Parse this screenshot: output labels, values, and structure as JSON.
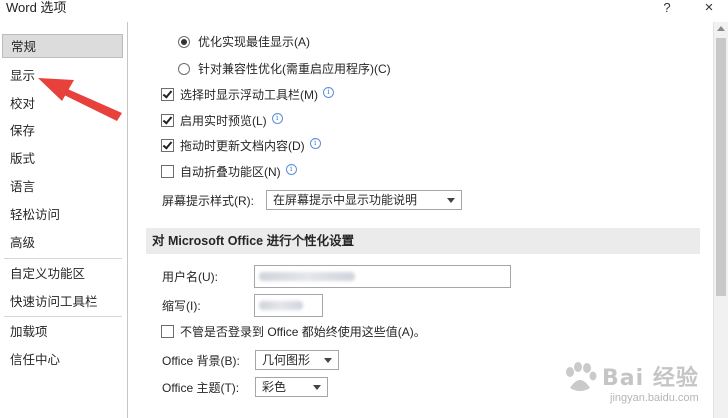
{
  "window": {
    "title": "Word 选项",
    "help_label": "?",
    "close_label": "×"
  },
  "sidebar": {
    "items": [
      {
        "label": "常规"
      },
      {
        "label": "显示"
      },
      {
        "label": "校对"
      },
      {
        "label": "保存"
      },
      {
        "label": "版式"
      },
      {
        "label": "语言"
      },
      {
        "label": "轻松访问"
      },
      {
        "label": "高级"
      },
      {
        "label": "自定义功能区"
      },
      {
        "label": "快速访问工具栏"
      },
      {
        "label": "加载项"
      },
      {
        "label": "信任中心"
      }
    ],
    "selected": "常规"
  },
  "ui_options": {
    "radio_best_display": "优化实现最佳显示(A)",
    "radio_compat": "针对兼容性优化(需重启应用程序)(C)",
    "show_mini_toolbar": "选择时显示浮动工具栏(M)",
    "live_preview": "启用实时预览(L)",
    "update_while_drag": "拖动时更新文档内容(D)",
    "collapse_ribbon": "自动折叠功能区(N)",
    "screentip_label": "屏幕提示样式(R):",
    "screentip_value": "在屏幕提示中显示功能说明",
    "info_glyph": "i"
  },
  "personalize": {
    "section_title": "对 Microsoft Office 进行个性化设置",
    "username_label": "用户名(U):",
    "initials_label": "缩写(I):",
    "always_use": "不管是否登录到 Office 都始终使用这些值(A)。",
    "background_label": "Office 背景(B):",
    "background_value": "几何图形",
    "theme_label": "Office 主题(T):",
    "theme_value": "彩色"
  },
  "watermark": {
    "brand": "Bai 经验",
    "url": "jingyan.baidu.com"
  },
  "colors": {
    "annotation_arrow": "#e8413b",
    "selected_nav_bg": "#dcdcdc",
    "section_bg": "#ebebeb",
    "info_icon": "#3a78d0"
  }
}
